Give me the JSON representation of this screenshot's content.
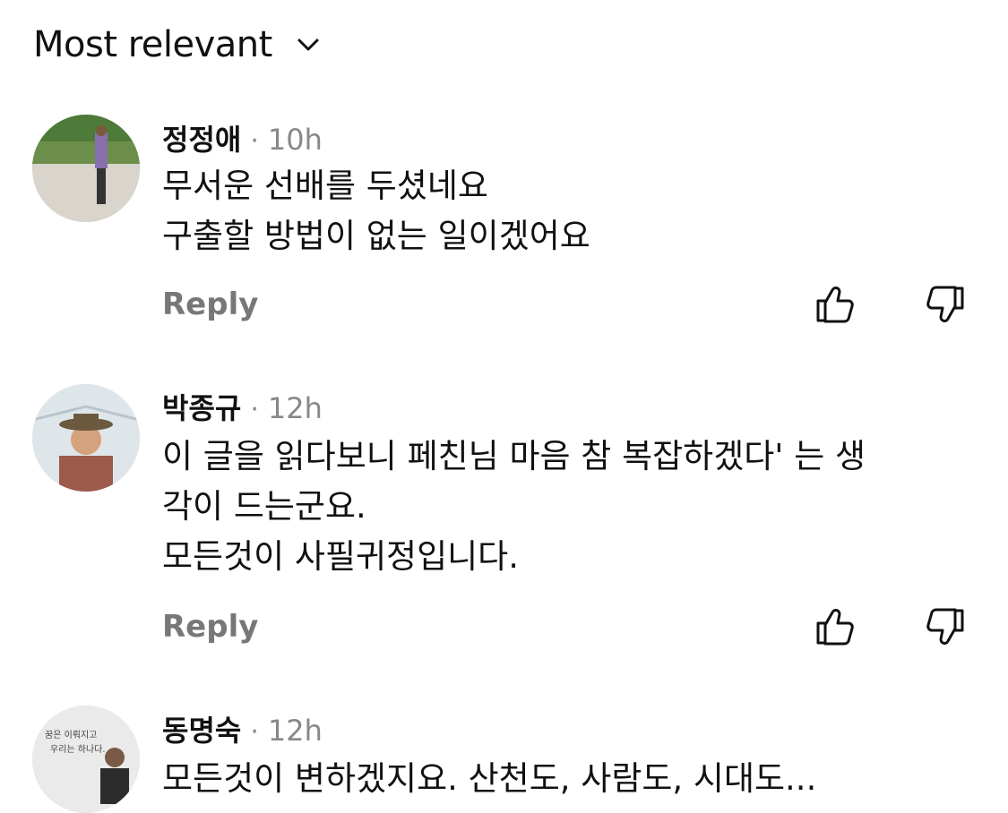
{
  "sort": {
    "label": "Most relevant",
    "icon": "chevron-down-icon"
  },
  "comments": [
    {
      "author": "정정애",
      "time": "10h",
      "lines": [
        "무서운 선배를 두셨네요",
        "구출할 방법이 없는 일이겠어요"
      ],
      "reply_label": "Reply"
    },
    {
      "author": "박종규",
      "time": "12h",
      "lines": [
        "이 글을 읽다보니 페친님 마음 참 복잡하겠다' 는 생",
        "각이 드는군요.",
        "모든것이 사필귀정입니다."
      ],
      "reply_label": "Reply"
    },
    {
      "author": "동명숙",
      "time": "12h",
      "lines": [
        "모든것이 변하겠지요. 산천도, 사람도, 시대도..."
      ],
      "avatar_text": [
        "꿈은 이뤄지고",
        "우리는 하나다."
      ]
    }
  ],
  "separator": "·",
  "colors": {
    "text": "#111111",
    "muted": "#888888",
    "reply": "#777777"
  }
}
